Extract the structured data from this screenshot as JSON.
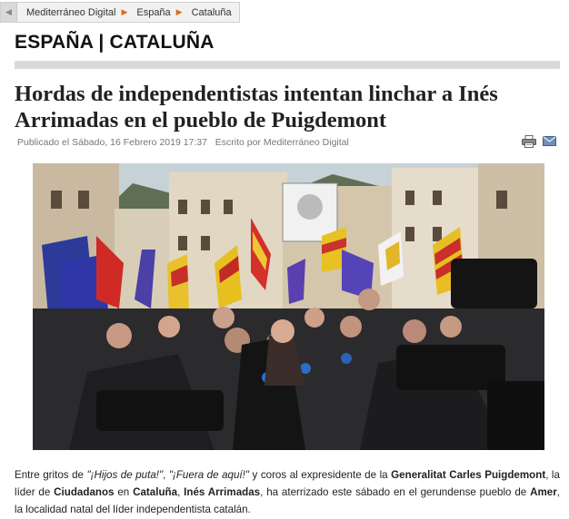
{
  "breadcrumb": {
    "items": [
      "Mediterráneo Digital",
      "España",
      "Cataluña"
    ]
  },
  "section_title": "ESPAÑA | CATALUÑA",
  "article": {
    "headline": "Hordas de independentistas intentan linchar a Inés Arrimadas en el pueblo de Puigdemont",
    "published": "Publicado el Sábado, 16 Febrero 2019 17:37",
    "author": "Escrito por Mediterráneo Digital",
    "body": {
      "t1": "Entre gritos de ",
      "q1": "\"¡Hijos de puta!\"",
      "t2": ", ",
      "q2": "\"¡Fuera de aquí!\"",
      "t3": " y coros al expresidente de la ",
      "b1": "Generalitat Carles Puigdemont",
      "t4": ", la líder de ",
      "b2": "Ciudadanos",
      "t5": " en ",
      "b3": "Cataluña",
      "t6": ", ",
      "b4": "Inés Arrimadas",
      "t7": ", ha aterrizado este sábado en el gerundense pueblo de ",
      "b5": "Amer",
      "t8": ", la localidad natal del líder independentista catalán."
    }
  },
  "icons": {
    "print": "print-icon",
    "email": "email-icon",
    "breadcrumb_back": "chevron-left-icon",
    "breadcrumb_separator": "triangle-right-icon"
  },
  "colors": {
    "accent": "#e06a1b",
    "rule": "#d9d9d9"
  }
}
